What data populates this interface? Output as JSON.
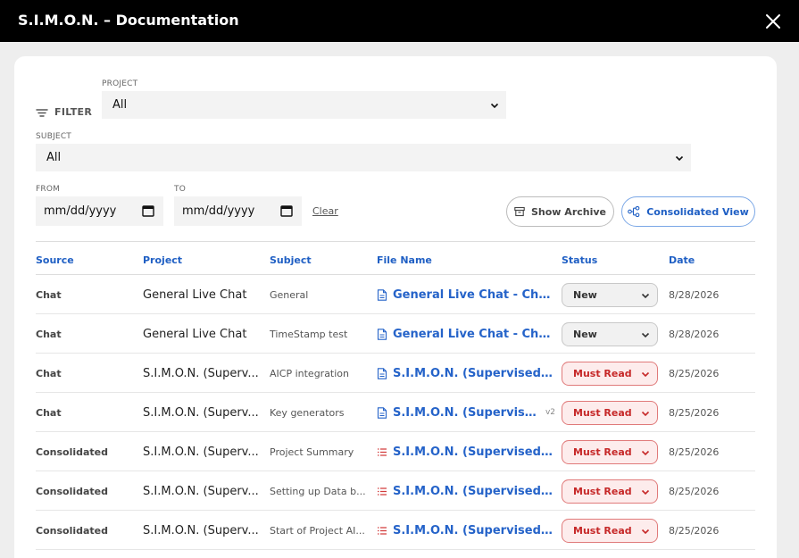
{
  "window": {
    "title": "S.I.M.O.N. – Documentation"
  },
  "filters": {
    "filter_label": "FILTER",
    "project_label": "PROJECT",
    "project_value": "All",
    "subject_label": "SUBJECT",
    "subject_value": "All",
    "from_label": "FROM",
    "from_value": "mm/dd/yyyy",
    "to_label": "TO",
    "to_value": "mm/dd/yyyy",
    "clear_label": "Clear"
  },
  "actions": {
    "archive_label": "Show Archive",
    "consolidated_label": "Consolidated View"
  },
  "table": {
    "headers": {
      "source": "Source",
      "project": "Project",
      "subject": "Subject",
      "file": "File Name",
      "status": "Status",
      "date": "Date"
    },
    "rows": [
      {
        "source": "Chat",
        "project": "General Live Chat",
        "subject": "General",
        "file": "General Live Chat - Chat ...",
        "file_icon": "document-icon",
        "version": "",
        "status": "New",
        "status_kind": "new",
        "date": "8/28/2026"
      },
      {
        "source": "Chat",
        "project": "General Live Chat",
        "subject": "TimeStamp test",
        "file": "General Live Chat - Chat ...",
        "file_icon": "document-icon",
        "version": "",
        "status": "New",
        "status_kind": "new",
        "date": "8/28/2026"
      },
      {
        "source": "Chat",
        "project": "S.I.M.O.N. (Superv...",
        "subject": "AICP integration",
        "file": "S.I.M.O.N. (Supervised In...",
        "file_icon": "document-icon",
        "version": "",
        "status": "Must Read",
        "status_kind": "must",
        "date": "8/25/2026"
      },
      {
        "source": "Chat",
        "project": "S.I.M.O.N. (Superv...",
        "subject": "Key generators",
        "file": "S.I.M.O.N. (Supervised...",
        "file_icon": "document-icon",
        "version": "v2",
        "status": "Must Read",
        "status_kind": "must",
        "date": "8/25/2026"
      },
      {
        "source": "Consolidated",
        "project": "S.I.M.O.N. (Superv...",
        "subject": "Project Summary",
        "file": "S.I.M.O.N. (Supervised In...",
        "file_icon": "list-icon",
        "version": "",
        "status": "Must Read",
        "status_kind": "must",
        "date": "8/25/2026"
      },
      {
        "source": "Consolidated",
        "project": "S.I.M.O.N. (Superv...",
        "subject": "Setting up Data b...",
        "file": "S.I.M.O.N. (Supervised In...",
        "file_icon": "list-icon",
        "version": "",
        "status": "Must Read",
        "status_kind": "must",
        "date": "8/25/2026"
      },
      {
        "source": "Consolidated",
        "project": "S.I.M.O.N. (Superv...",
        "subject": "Start of Project AI...",
        "file": "S.I.M.O.N. (Supervised In...",
        "file_icon": "list-icon",
        "version": "",
        "status": "Must Read",
        "status_kind": "must",
        "date": "8/25/2026"
      }
    ]
  },
  "colors": {
    "accent": "#2563c9",
    "must_read": "#c62828",
    "must_read_bg": "#fdecec",
    "titlebar": "#000000"
  }
}
